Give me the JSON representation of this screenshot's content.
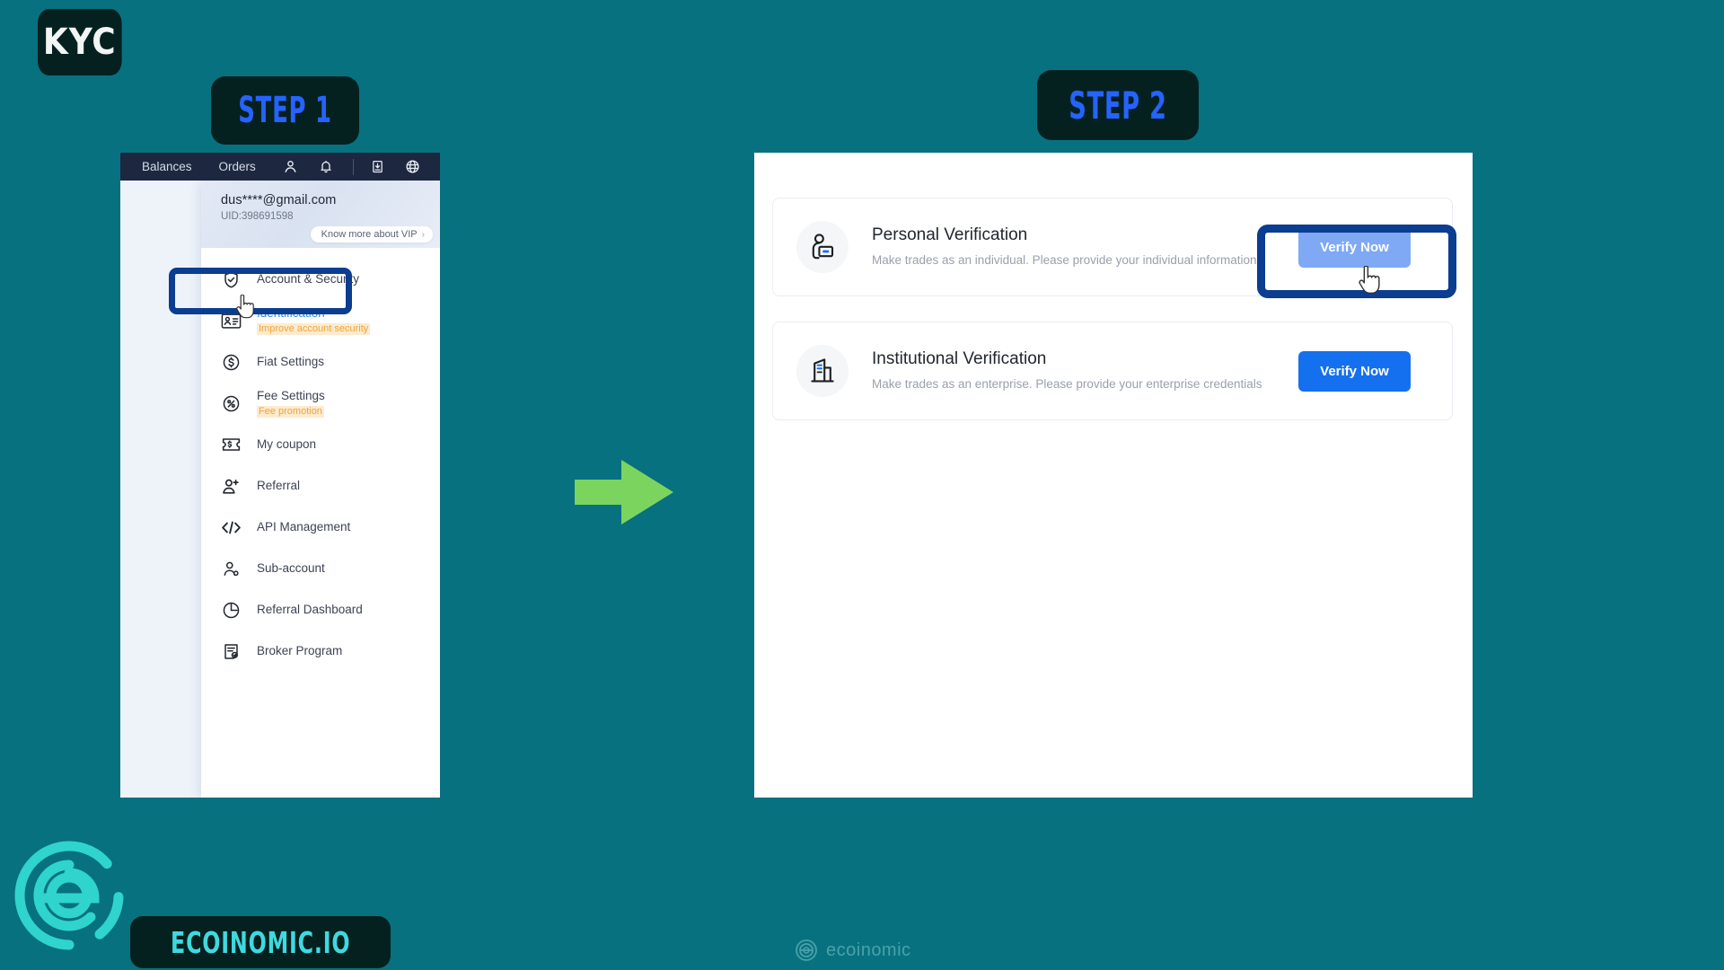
{
  "badges": {
    "kyc": "KYC",
    "step1": "STEP 1",
    "step2": "STEP 2"
  },
  "colors": {
    "background": "#07717F",
    "badge_bg": "#04211F",
    "step_text": "#2563FF",
    "highlight_ring": "#0B3D91",
    "arrow": "#7BD45E",
    "primary_button": "#1570EF",
    "disabled_button": "#7FA9F5",
    "logo_teal": "#3FD9E0",
    "nav_bar": "#1D2740"
  },
  "left_panel": {
    "topnav": {
      "items": [
        {
          "label": "Balances",
          "type": "text"
        },
        {
          "label": "Orders",
          "type": "text"
        },
        {
          "label": "",
          "type": "icon",
          "icon": "user-icon"
        },
        {
          "label": "",
          "type": "icon",
          "icon": "bell-icon"
        },
        {
          "label": "",
          "type": "icon",
          "icon": "download-box-icon"
        },
        {
          "label": "",
          "type": "icon",
          "icon": "globe-icon"
        }
      ]
    },
    "dropdown": {
      "email": "dus****@gmail.com",
      "uid": "UID:398691598",
      "vip_chip": "Know more about VIP",
      "vip_chip_chevron": "›",
      "items": [
        {
          "label": "Account & Security",
          "sub": "",
          "icon": "shield-check-icon",
          "active": false
        },
        {
          "label": "Identification",
          "sub": "Improve account security",
          "icon": "id-card-icon",
          "active": true
        },
        {
          "label": "Fiat Settings",
          "sub": "",
          "icon": "dollar-circle-icon",
          "active": false
        },
        {
          "label": "Fee Settings",
          "sub": "Fee promotion",
          "icon": "percent-circle-icon",
          "active": false
        },
        {
          "label": "My coupon",
          "sub": "",
          "icon": "coupon-icon",
          "active": false
        },
        {
          "label": "Referral",
          "sub": "",
          "icon": "user-plus-icon",
          "active": false
        },
        {
          "label": "API Management",
          "sub": "",
          "icon": "code-icon",
          "active": false
        },
        {
          "label": "Sub-account",
          "sub": "",
          "icon": "sub-account-icon",
          "active": false
        },
        {
          "label": "Referral Dashboard",
          "sub": "",
          "icon": "pie-clock-icon",
          "active": false
        },
        {
          "label": "Broker Program",
          "sub": "",
          "icon": "document-check-icon",
          "active": false
        }
      ]
    }
  },
  "right_panel": {
    "cards": [
      {
        "title": "Personal Verification",
        "description": "Make trades as an individual. Please provide your individual information",
        "button": "Verify Now",
        "icon": "personal-verification-icon",
        "state": "highlighted"
      },
      {
        "title": "Institutional Verification",
        "description": "Make trades as an enterprise. Please provide your enterprise credentials",
        "button": "Verify Now",
        "icon": "institutional-verification-icon",
        "state": "default"
      }
    ]
  },
  "footer": {
    "brand_pill": "ECOINOMIC.IO",
    "watermark": "ecoinomic"
  }
}
